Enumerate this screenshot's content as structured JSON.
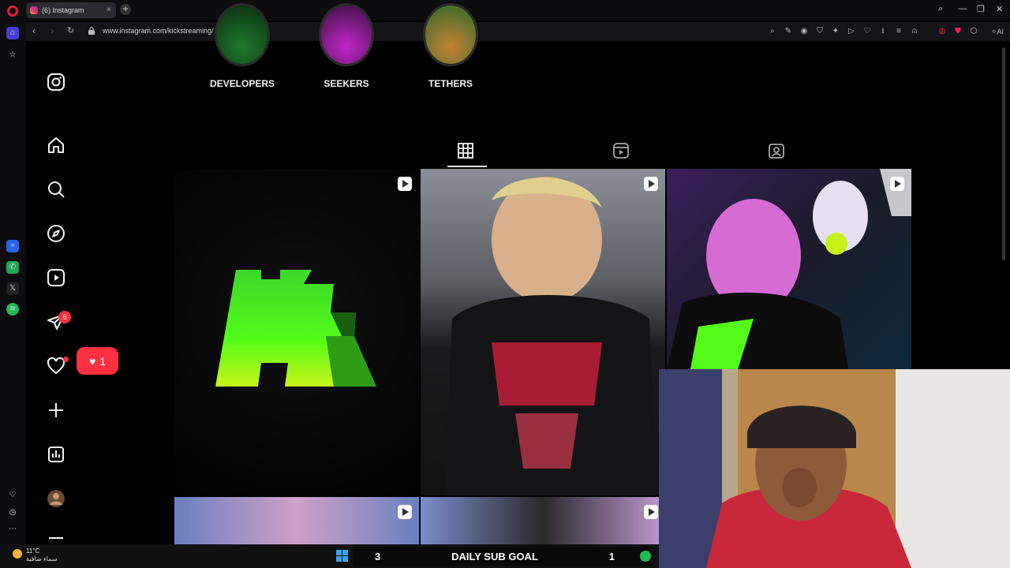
{
  "browser": {
    "tab_title": "(6) Instagram",
    "url": "www.instagram.com/kickstreaming/",
    "ai_label": "AI"
  },
  "instagram": {
    "notifications_badge": "6",
    "like_popup_count": "1",
    "highlights": [
      {
        "label": "DEVELOPERS"
      },
      {
        "label": "SEEKERS"
      },
      {
        "label": "TETHERS"
      }
    ],
    "profile_tabs": [
      {
        "name": "posts",
        "icon": "grid-icon",
        "active": true
      },
      {
        "name": "reels",
        "icon": "reels-icon",
        "active": false
      },
      {
        "name": "tagged",
        "icon": "tagged-icon",
        "active": false
      }
    ]
  },
  "taskbar": {
    "temperature": "11°C",
    "weather_text": "سماء صافية",
    "goal_left": "3",
    "goal_label": "DAILY SUB GOAL",
    "goal_right": "1"
  },
  "colors": {
    "accent_red": "#ff3040",
    "kick_green": "#53fc18",
    "spotify_green": "#1db954"
  }
}
